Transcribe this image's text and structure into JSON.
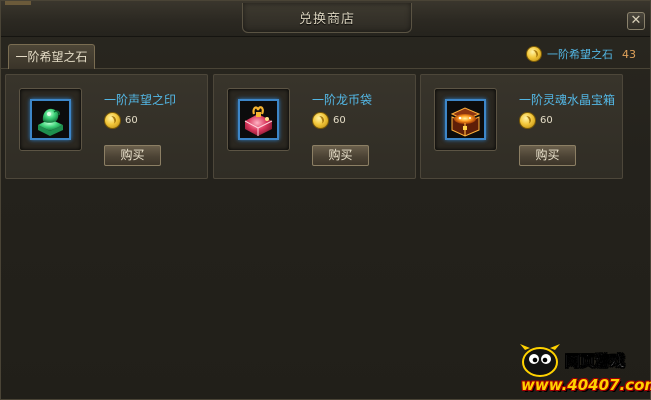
{
  "window": {
    "title": "兑换商店",
    "close_label": "✕"
  },
  "tab": {
    "label": "一阶希望之石"
  },
  "currency": {
    "icon": "gold-coin-icon",
    "name": "一阶希望之石",
    "count": "43"
  },
  "items": [
    {
      "name": "一阶声望之印",
      "price": "60",
      "buy_label": "购买",
      "icon": "jade-seal-icon"
    },
    {
      "name": "一阶龙币袋",
      "price": "60",
      "buy_label": "购买",
      "icon": "coin-bag-icon"
    },
    {
      "name": "一阶灵魂水晶宝箱",
      "price": "60",
      "buy_label": "购买",
      "icon": "treasure-chest-icon"
    }
  ],
  "watermark": {
    "line1": "网页游戏",
    "line2": "www.40407.com"
  },
  "colors": {
    "item_name": "#53b8e6",
    "currency_count": "#e0a25a",
    "slot_border": "#3d86c8"
  }
}
